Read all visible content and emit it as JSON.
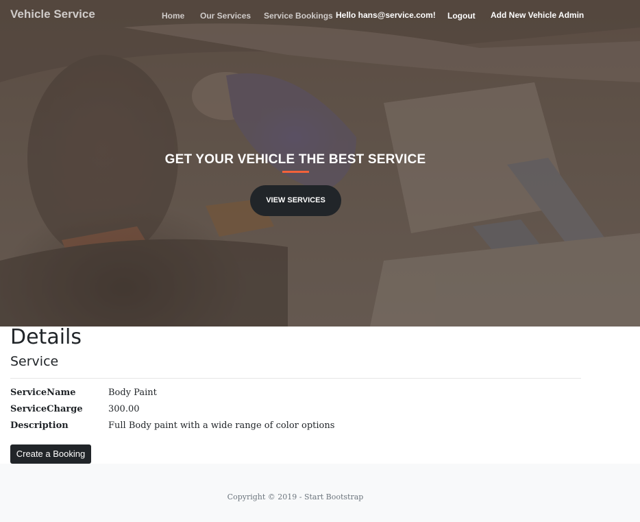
{
  "nav": {
    "brand": "Vehicle Service",
    "links": [
      {
        "label": "Home"
      },
      {
        "label": "Our Services"
      },
      {
        "label": "Service Bookings"
      },
      {
        "label": "Hello hans@service.com!"
      },
      {
        "label": "Logout"
      },
      {
        "label": "Add New Vehicle Admin"
      }
    ]
  },
  "hero": {
    "title": "GET YOUR VEHICLE THE BEST SERVICE",
    "button": "VIEW SERVICES",
    "accent_color": "#f4623a"
  },
  "details": {
    "title": "Details",
    "subtitle": "Service",
    "fields": [
      {
        "label": "ServiceName",
        "value": "Body Paint"
      },
      {
        "label": "ServiceCharge",
        "value": "300.00"
      },
      {
        "label": "Description",
        "value": "Full Body paint with a wide range of color options"
      }
    ],
    "button": "Create a Booking"
  },
  "footer": {
    "copyright": "Copyright © 2019 - Start Bootstrap"
  }
}
